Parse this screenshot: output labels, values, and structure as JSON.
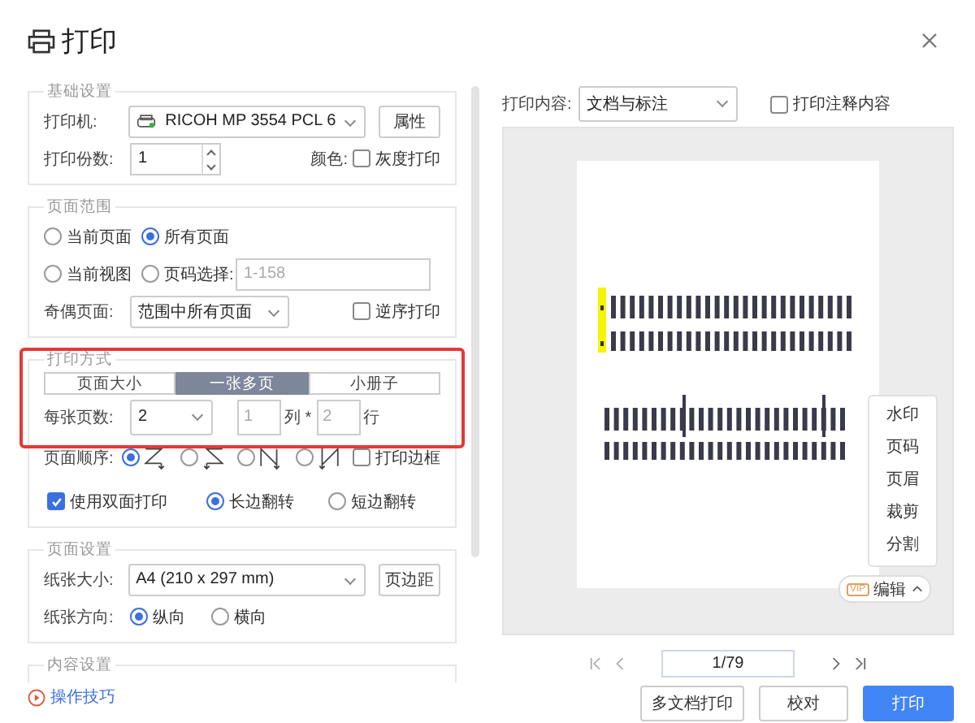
{
  "window": {
    "title": "打印"
  },
  "basic": {
    "legend": "基础设置",
    "printer_label": "打印机:",
    "printer": "RICOH MP 3554 PCL 6",
    "properties_button": "属性",
    "copies_label": "打印份数:",
    "copies": "1",
    "color_label": "颜色:",
    "grayscale": {
      "label": "灰度打印",
      "checked": false
    }
  },
  "range": {
    "legend": "页面范围",
    "options": [
      {
        "label": "当前页面",
        "selected": false
      },
      {
        "label": "所有页面",
        "selected": true
      },
      {
        "label": "当前视图",
        "selected": false
      },
      {
        "label": "页码选择:",
        "selected": false
      }
    ],
    "pages_placeholder": "1-158",
    "odd_even_label": "奇偶页面:",
    "odd_even": "范围中所有页面",
    "reverse": {
      "label": "逆序打印",
      "checked": false
    }
  },
  "mode": {
    "legend": "打印方式",
    "tabs": [
      {
        "label": "页面大小",
        "selected": false
      },
      {
        "label": "一张多页",
        "selected": true
      },
      {
        "label": "小册子",
        "selected": false
      }
    ],
    "per_sheet_label": "每张页数:",
    "per_sheet": "2",
    "cols": "1",
    "cols_label": "列 *",
    "rows": "2",
    "rows_label": "行",
    "order_label": "页面顺序:",
    "orders": [
      {
        "kind": "z",
        "selected": true
      },
      {
        "kind": "z-reverse",
        "selected": false
      },
      {
        "kind": "n",
        "selected": false
      },
      {
        "kind": "n-reverse",
        "selected": false
      }
    ],
    "border": {
      "label": "打印边框",
      "checked": false
    },
    "duplex": {
      "label": "使用双面打印",
      "checked": true
    },
    "flip": [
      {
        "label": "长边翻转",
        "selected": true
      },
      {
        "label": "短边翻转",
        "selected": false
      }
    ]
  },
  "page_setup": {
    "legend": "页面设置",
    "paper_label": "纸张大小:",
    "paper": "A4 (210 x 297 mm)",
    "margins_button": "页边距",
    "orientation_label": "纸张方向:",
    "orientations": [
      {
        "label": "纵向",
        "selected": true
      },
      {
        "label": "横向",
        "selected": false
      }
    ]
  },
  "content_setup": {
    "legend": "内容设置"
  },
  "tips_link": "操作技巧",
  "preview": {
    "content_label": "打印内容:",
    "content": "文档与标注",
    "annotations": {
      "label": "打印注释内容",
      "checked": false
    },
    "edit_menu": [
      "水印",
      "页码",
      "页眉",
      "裁剪",
      "分割"
    ],
    "vip_badge": "VIP",
    "edit_button": "编辑",
    "page": "1/79"
  },
  "buttons": [
    {
      "label": "多文档打印",
      "kind": "secondary"
    },
    {
      "label": "校对",
      "kind": "secondary"
    },
    {
      "label": "打印",
      "kind": "primary"
    }
  ]
}
